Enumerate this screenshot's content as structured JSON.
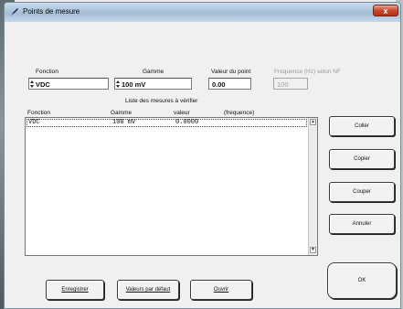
{
  "window": {
    "title": "Points de mesure",
    "close_label": "x"
  },
  "form": {
    "fonction_label": "Fonction",
    "fonction_value": "VDC",
    "gamme_label": "Gamme",
    "gamme_value": "100 mV",
    "valeur_label": "Valeur du point",
    "valeur_value": "0.00",
    "frequence_label": "Frequence (Hz) selon NF",
    "frequence_value": "100"
  },
  "list": {
    "caption": "Liste des mesures à vérifier",
    "columns": [
      "Fonction",
      "Gamme",
      "valeur",
      "(frequence)"
    ],
    "rows": [
      {
        "fonction": "VDC",
        "gamme": "100 mV",
        "valeur": "0.0000"
      }
    ]
  },
  "buttons": {
    "coller": "Coller",
    "copier": "Copier",
    "couper": "Couper",
    "annuler": "Annuler",
    "ok": "OK",
    "enregistrer": "Enregistrer",
    "valeurs_defaut": "Valeurs par défaut",
    "ouvrir": "Ouvrir"
  }
}
